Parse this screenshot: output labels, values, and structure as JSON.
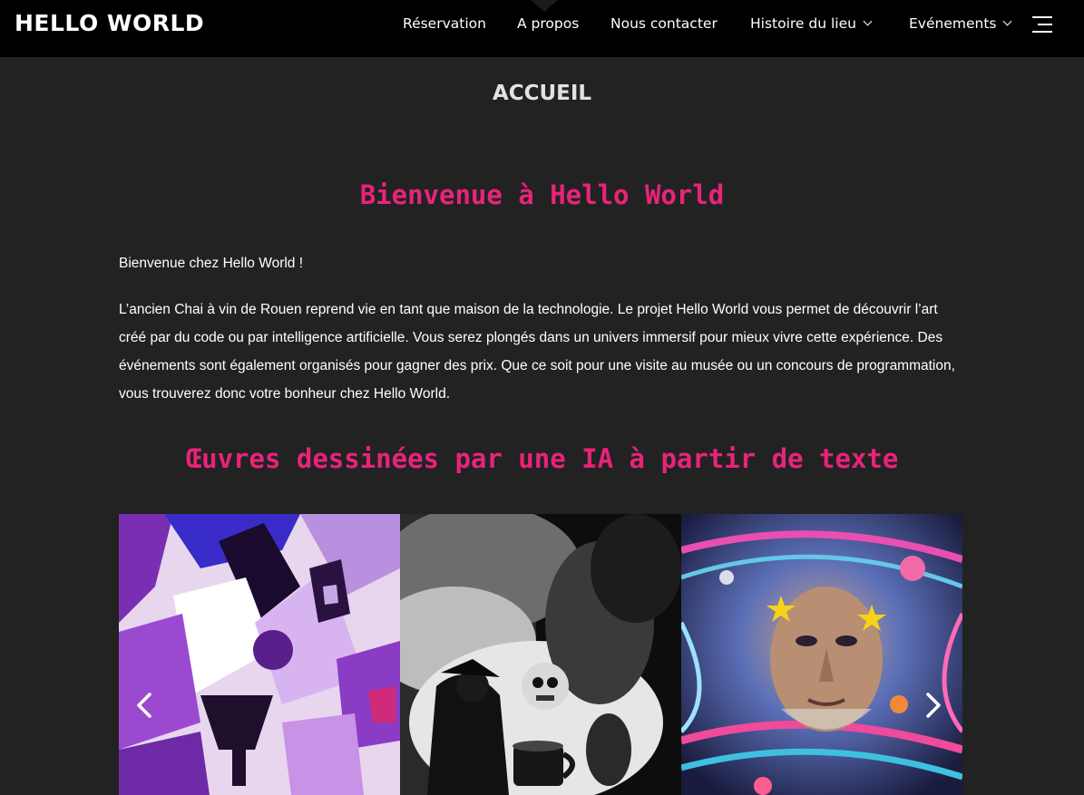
{
  "header": {
    "logo": "HELLO WORLD",
    "nav": [
      {
        "label": "Réservation",
        "has_dropdown": false
      },
      {
        "label": "A propos",
        "has_dropdown": false,
        "active": true
      },
      {
        "label": "Nous contacter",
        "has_dropdown": false
      },
      {
        "label": "Histoire du lieu",
        "has_dropdown": true
      },
      {
        "label": "Evénements",
        "has_dropdown": true
      }
    ],
    "menu_icon": "hamburger-menu-icon"
  },
  "main": {
    "page_title": "ACCUEIL",
    "welcome_heading": "Bienvenue à Hello World",
    "intro": "Bienvenue chez Hello World !",
    "description": "L’ancien Chai à vin de Rouen reprend vie en tant que maison de la technologie. Le projet Hello World vous permet de découvrir l’art créé par du code ou par intelligence artificielle. Vous serez plongés dans un univers immersif pour mieux vivre cette expérience. Des événements sont également organisés pour gagner des prix. Que ce soit pour une visite au musée ou un concours de programmation, vous trouverez donc votre bonheur chez Hello World.",
    "gallery_heading": "Œuvres dessinées par une IA à partir de texte",
    "gallery": {
      "items": [
        {
          "kind": "purple cubist abstract"
        },
        {
          "kind": "black and white fantasy figures"
        },
        {
          "kind": "cosmic psychedelic face"
        }
      ],
      "prev_icon": "chevron-left-icon",
      "next_icon": "chevron-right-icon"
    }
  },
  "colors": {
    "background": "#222222",
    "header": "#000000",
    "accent_pink": "#e8237a",
    "title_gray": "#e2e2e2"
  }
}
